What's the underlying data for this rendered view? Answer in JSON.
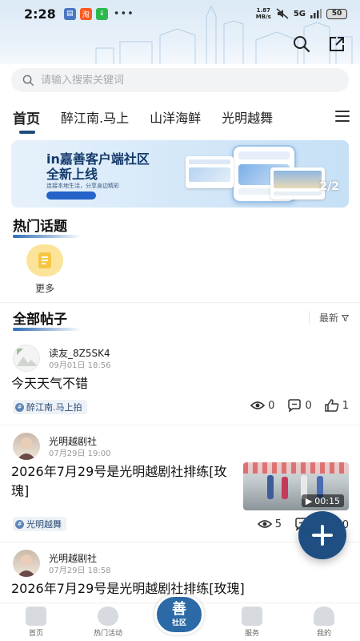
{
  "status_bar": {
    "time": "2:28",
    "net_speed_value": "1.87",
    "net_speed_unit": "MB/s",
    "signal": "5G",
    "battery": "50"
  },
  "search": {
    "placeholder": "请输入搜索关键词"
  },
  "tabs": [
    {
      "label": "首页",
      "active": true
    },
    {
      "label": "醉江南.马上"
    },
    {
      "label": "山洋海鲜"
    },
    {
      "label": "光明越舞"
    }
  ],
  "banner": {
    "title_line1": "in嘉善客户端社区",
    "title_line2": "全新上线",
    "subtitle": "连接本地生活，分享身边精彩",
    "counter": "2/2"
  },
  "hot_topics": {
    "title": "热门话题",
    "more_label": "更多"
  },
  "all_posts": {
    "title": "全部帖子",
    "sort_label": "最新"
  },
  "posts": [
    {
      "author": "读友_8Z5SK4",
      "time": "09月01日 18:56",
      "title": "今天天气不错",
      "tag": "醉江南.马上拍",
      "views": "0",
      "comments": "0",
      "likes": "1"
    },
    {
      "author": "光明越剧社",
      "time": "07月29日 19:00",
      "title": "2026年7月29号是光明越剧社排练[玫瑰]",
      "tag": "光明越舞",
      "views": "5",
      "comments": "0",
      "video_duration": "00:15"
    },
    {
      "author": "光明越剧社",
      "time": "07月29日 18:58",
      "title": "2026年7月29号是光明越剧社排练[玫瑰]"
    }
  ],
  "bottom_nav": {
    "home": "首页",
    "activities": "热门活动",
    "community": "社区",
    "community_logo": "善",
    "services": "服务",
    "mine": "我的"
  },
  "colors": {
    "accent": "#1f4f82",
    "tag_bg": "#eef2f7",
    "topic_yellow": "#fbe49a"
  }
}
